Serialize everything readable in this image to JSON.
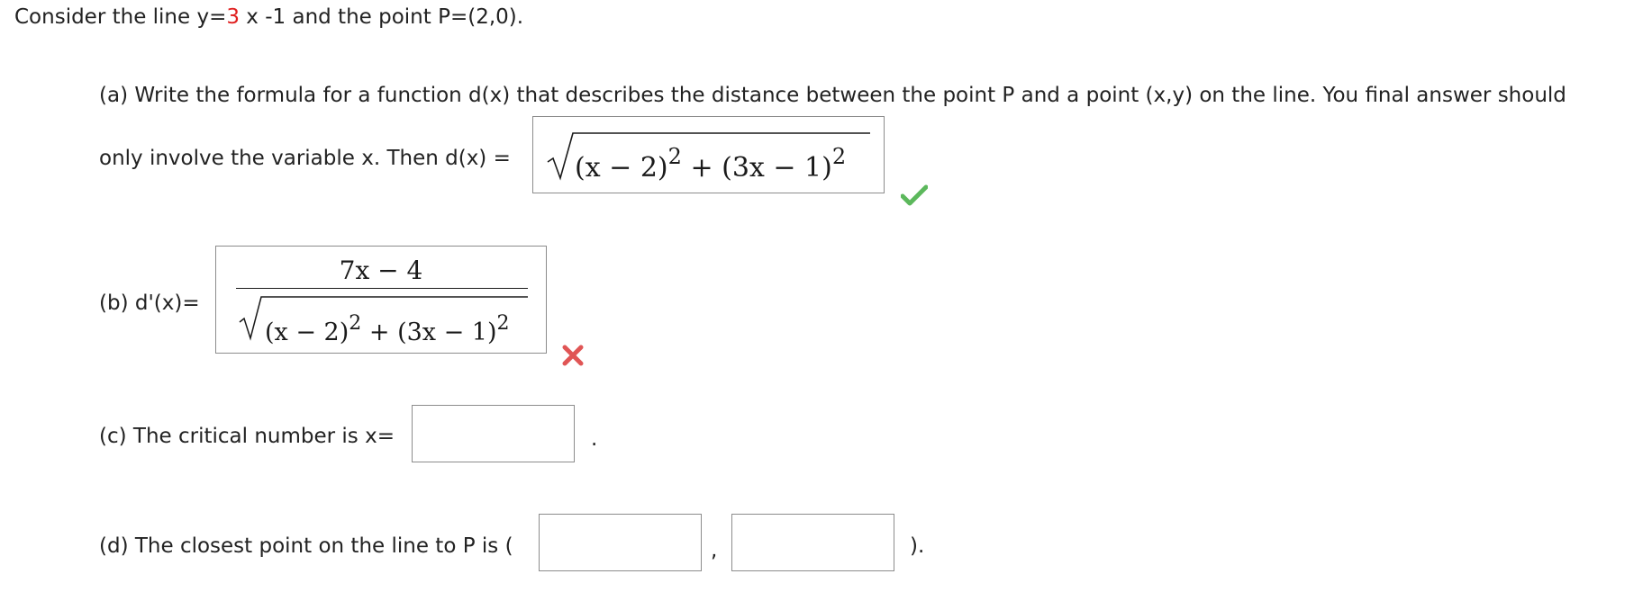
{
  "problem": {
    "intro_before": "Consider the line y=",
    "slope": "3",
    "intro_after": " x -1 and the point P=(2,0)."
  },
  "part_a": {
    "line1": "(a) Write the formula for a function d(x) that describes the distance between the point P and a point (x,y) on the line. You final answer should",
    "line2": "only involve the variable x. Then d(x) =",
    "answer": {
      "t1": "(x − 2)",
      "e1": "2",
      "plus": "+",
      "t2": "(3x − 1)",
      "e2": "2"
    },
    "status": "correct"
  },
  "part_b": {
    "label": "(b) d'(x)=",
    "answer": {
      "numerator": "7x − 4",
      "t1": "(x − 2)",
      "e1": "2",
      "plus": "+",
      "t2": "(3x − 1)",
      "e2": "2"
    },
    "status": "incorrect"
  },
  "part_c": {
    "label": "(c) The critical number is x=",
    "value": "",
    "suffix": "."
  },
  "part_d": {
    "label": "(d) The closest point on the line to P is (",
    "x_value": "",
    "comma": ",",
    "y_value": "",
    "suffix": ")."
  },
  "colors": {
    "check": "#5cb85c",
    "cross": "#e05555",
    "slope_highlight": "#e02020"
  },
  "icons": {
    "correct": "checkmark-icon",
    "incorrect": "cross-icon"
  }
}
